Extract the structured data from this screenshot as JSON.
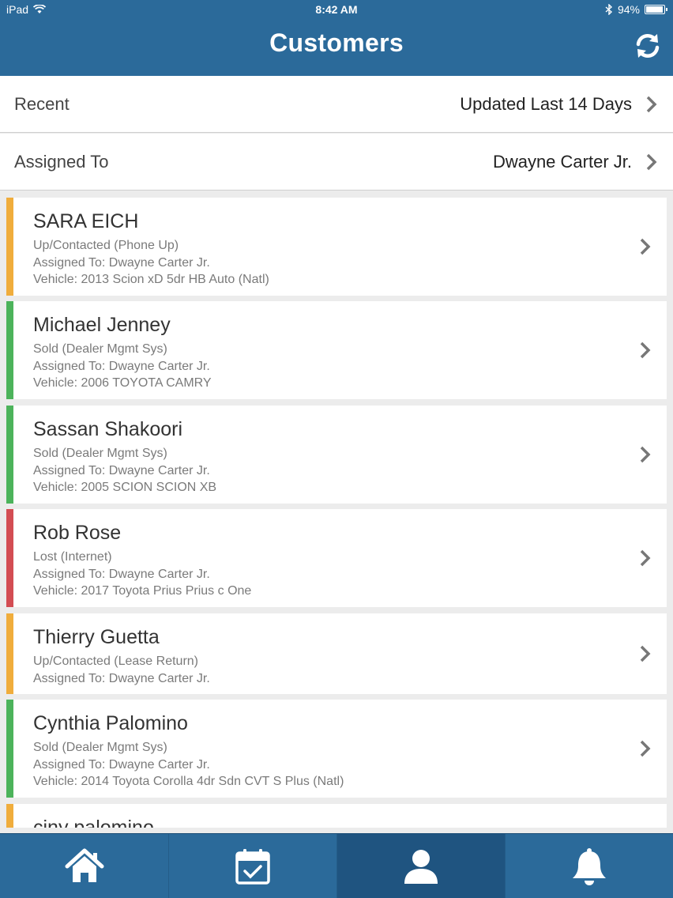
{
  "statusbar": {
    "device": "iPad",
    "time": "8:42 AM",
    "battery": "94%",
    "battery_level": 0.94
  },
  "header": {
    "title": "Customers",
    "refresh_icon": "refresh-icon"
  },
  "filters": [
    {
      "label": "Recent",
      "value": "Updated Last 14 Days"
    },
    {
      "label": "Assigned To",
      "value": "Dwayne Carter Jr."
    }
  ],
  "colors": {
    "header": "#2b6a9a",
    "orange": "#f0ad3c",
    "green": "#4cb35b",
    "red": "#d34d53"
  },
  "customers": [
    {
      "name": "SARA EICH",
      "status": "Up/Contacted (Phone Up)",
      "assigned": "Assigned To: Dwayne Carter Jr.",
      "vehicle": "Vehicle: 2013 Scion xD 5dr HB Auto (Natl)",
      "color": "#f0ad3c"
    },
    {
      "name": "Michael Jenney",
      "status": "Sold (Dealer Mgmt Sys)",
      "assigned": "Assigned To: Dwayne Carter Jr.",
      "vehicle": "Vehicle: 2006 TOYOTA CAMRY",
      "color": "#4cb35b"
    },
    {
      "name": "Sassan Shakoori",
      "status": "Sold (Dealer Mgmt Sys)",
      "assigned": "Assigned To: Dwayne Carter Jr.",
      "vehicle": "Vehicle: 2005 SCION SCION XB",
      "color": "#4cb35b"
    },
    {
      "name": "Rob Rose",
      "status": "Lost (Internet)",
      "assigned": "Assigned To: Dwayne Carter Jr.",
      "vehicle": "Vehicle: 2017 Toyota Prius  Prius c One",
      "color": "#d34d53"
    },
    {
      "name": "Thierry Guetta",
      "status": "Up/Contacted (Lease Return)",
      "assigned": "Assigned To: Dwayne Carter Jr.",
      "vehicle": "",
      "color": "#f0ad3c"
    },
    {
      "name": "Cynthia Palomino",
      "status": "Sold (Dealer Mgmt Sys)",
      "assigned": "Assigned To: Dwayne Carter Jr.",
      "vehicle": "Vehicle: 2014 Toyota Corolla 4dr Sdn CVT S Plus (Natl)",
      "color": "#4cb35b"
    },
    {
      "name": "ciny palomino",
      "status": "",
      "assigned": "",
      "vehicle": "",
      "color": "#f0ad3c"
    }
  ],
  "tabs": [
    {
      "icon": "home-icon",
      "active": false
    },
    {
      "icon": "calendar-icon",
      "active": false
    },
    {
      "icon": "person-icon",
      "active": true
    },
    {
      "icon": "bell-icon",
      "active": false
    }
  ]
}
